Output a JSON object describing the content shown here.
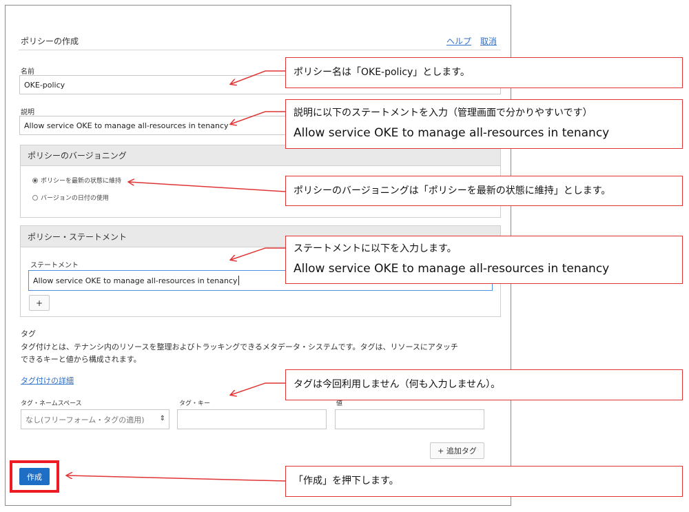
{
  "dialog": {
    "title": "ポリシーの作成",
    "help_link": "ヘルプ",
    "cancel_link": "取消"
  },
  "name_field": {
    "label": "名前",
    "value": "OKE-policy"
  },
  "description_field": {
    "label": "説明",
    "value": "Allow service OKE to manage all-resources in tenancy"
  },
  "versioning": {
    "heading": "ポリシーのバージョニング",
    "options": [
      {
        "label": "ポリシーを最新の状態に維持",
        "selected": true
      },
      {
        "label": "バージョンの日付の使用",
        "selected": false
      }
    ]
  },
  "statements": {
    "heading": "ポリシー・ステートメント",
    "label": "ステートメント",
    "value": "Allow service OKE to manage all-resources in tenancy",
    "add_button": "+"
  },
  "tags": {
    "heading": "タグ",
    "description_line1": "タグ付けとは、テナンシ内のリソースを整理およびトラッキングできるメタデータ・システムです。タグは、リソースにアタッチ",
    "description_line2": "できるキーと値から構成されます。",
    "details_link": "タグ付けの詳細",
    "namespace_label": "タグ・ネームスペース",
    "namespace_value": "なし(フリーフォーム・タグの適用)",
    "key_label": "タグ・キー",
    "value_label": "値",
    "add_tag_button": "+ 追加タグ"
  },
  "create_button": "作成",
  "callouts": {
    "name": "ポリシー名は「OKE-policy」とします。",
    "description_l1": "説明に以下のステートメントを入力（管理画面で分かりやすいです）",
    "description_l2": "Allow service OKE to manage all-resources in tenancy",
    "versioning": "ポリシーのバージョニングは「ポリシーを最新の状態に維持」とします。",
    "statement_l1": "ステートメントに以下を入力します。",
    "statement_l2": "Allow service OKE to manage all-resources in tenancy",
    "tags": "タグは今回利用しません（何も入力しません）。",
    "create": "「作成」を押下します。"
  },
  "colors": {
    "accent": "#1f6ec5",
    "callout_border": "#e03434",
    "highlight": "#ee1b24"
  }
}
